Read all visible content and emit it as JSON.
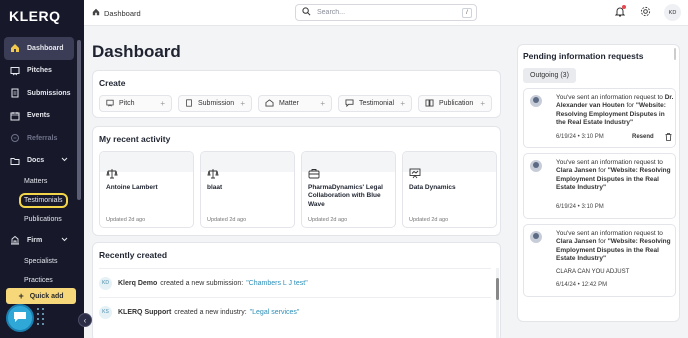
{
  "sidebar": {
    "logo": "KLERQ",
    "items": [
      {
        "label": "Dashboard"
      },
      {
        "label": "Pitches"
      },
      {
        "label": "Submissions"
      },
      {
        "label": "Events"
      },
      {
        "label": "Referrals"
      },
      {
        "label": "Docs"
      },
      {
        "label": "Matters"
      },
      {
        "label": "Testimonials"
      },
      {
        "label": "Publications"
      },
      {
        "label": "Firm"
      },
      {
        "label": "Specialists"
      },
      {
        "label": "Practices"
      }
    ],
    "quick_add_label": "Quick add"
  },
  "topbar": {
    "breadcrumb": "Dashboard",
    "search_placeholder": "Search...",
    "search_shortcut": "/",
    "user_initials": "KD"
  },
  "main": {
    "title": "Dashboard",
    "create": {
      "title": "Create",
      "buttons": [
        {
          "label": "Pitch",
          "icon": "pitch-icon"
        },
        {
          "label": "Submission",
          "icon": "submission-icon"
        },
        {
          "label": "Matter",
          "icon": "matter-icon"
        },
        {
          "label": "Testimonial",
          "icon": "testimonial-icon"
        },
        {
          "label": "Publication",
          "icon": "publication-icon"
        }
      ]
    },
    "activity": {
      "title": "My recent activity",
      "tiles": [
        {
          "name": "Antoine Lambert",
          "updated": "Updated 2d ago",
          "icon": "scales-icon"
        },
        {
          "name": "blaat",
          "updated": "Updated 2d ago",
          "icon": "scales-icon"
        },
        {
          "name": "PharmaDynamics' Legal Collaboration with Blue Wave",
          "updated": "Updated 2d ago",
          "icon": "briefcase-icon"
        },
        {
          "name": "Data Dynamics",
          "updated": "Updated 2d ago",
          "icon": "presentation-icon"
        }
      ]
    },
    "recent": {
      "title": "Recently created",
      "rows": [
        {
          "initials": "KD",
          "actor": "Klerq Demo",
          "text": "created a new submission:",
          "link": "\"Chambers L J test\""
        },
        {
          "initials": "KS",
          "actor": "KLERQ Support",
          "text": "created a new industry:",
          "link": "\"Legal services\""
        }
      ]
    }
  },
  "right_panel": {
    "title": "Pending information requests",
    "tab": "Outgoing (3)",
    "requests": [
      {
        "prefix": "You've sent an information request to",
        "name": "Dr. Alexander van Houten",
        "mid": "for",
        "subject": "\"Website: Resolving Employment Disputes in the Real Estate Industry\"",
        "date": "6/19/24 • 3:10 PM",
        "resend": "Resend",
        "note": ""
      },
      {
        "prefix": "You've sent an information request to",
        "name": "Clara Jansen",
        "mid": "for",
        "subject": "\"Website: Resolving Employment Disputes in the Real Estate Industry\"",
        "date": "6/19/24 • 3:10 PM",
        "resend": "",
        "note": ""
      },
      {
        "prefix": "You've sent an information request to",
        "name": "Clara Jansen",
        "mid": "for",
        "subject": "\"Website: Resolving Employment Disputes in the Real Estate Industry\"",
        "date": "6/14/24 • 12:42 PM",
        "resend": "",
        "note": "CLARA CAN YOU ADJUST"
      }
    ]
  }
}
